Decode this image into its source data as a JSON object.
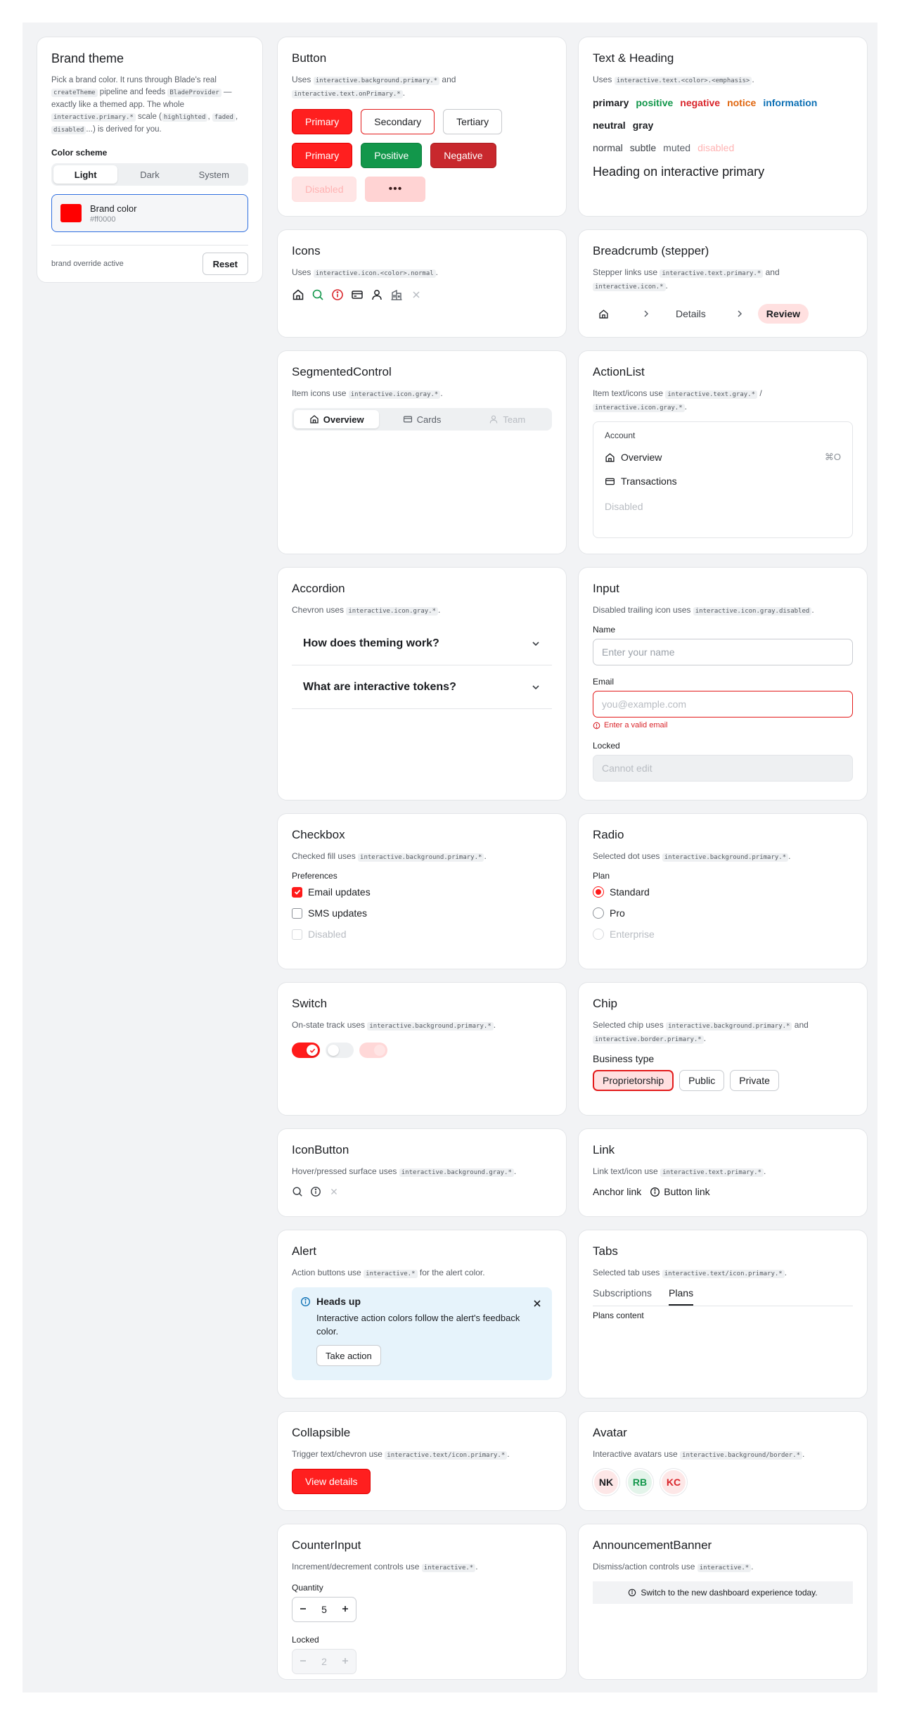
{
  "theme": {
    "title": "Brand theme",
    "desc_parts": [
      "Pick a brand color. It runs through Blade's real ",
      "createTheme",
      " pipeline and feeds ",
      "BladeProvider",
      " — exactly like a themed app. The whole ",
      "interactive.primary.*",
      " scale (",
      "highlighted",
      ", ",
      "faded",
      ", ",
      "disabled",
      "...) is derived for you."
    ],
    "color_scheme_label": "Color scheme",
    "schemes": [
      "Light",
      "Dark",
      "System"
    ],
    "selected_scheme": "Light",
    "brand_label": "Brand color",
    "brand_value": "#ff0000",
    "brand_color": "#ff0000",
    "override_text": "brand override active",
    "reset_label": "Reset"
  },
  "button": {
    "title": "Button",
    "desc_parts": [
      "Uses ",
      "interactive.background.primary.*",
      " and ",
      "interactive.text.onPrimary.*",
      "."
    ],
    "primary": "Primary",
    "secondary": "Secondary",
    "tertiary": "Tertiary",
    "primary2": "Primary",
    "positive": "Positive",
    "negative": "Negative",
    "disabled": "Disabled",
    "loading": "•••"
  },
  "text": {
    "title": "Text & Heading",
    "desc_parts": [
      "Uses ",
      "interactive.text.<color>.<emphasis>",
      "."
    ],
    "row1": [
      {
        "t": "primary",
        "c": "#1b1d21"
      },
      {
        "t": "positive",
        "c": "#12974b"
      },
      {
        "t": "negative",
        "c": "#d9242a"
      },
      {
        "t": "notice",
        "c": "#e0660f"
      },
      {
        "t": "information",
        "c": "#0a6fb4"
      }
    ],
    "row2": [
      {
        "t": "neutral",
        "c": "#1b1d21"
      },
      {
        "t": "gray",
        "c": "#1b1d21"
      }
    ],
    "row3": [
      {
        "t": "normal",
        "c": "#3b3f45"
      },
      {
        "t": "subtle",
        "c": "#3b3f45"
      },
      {
        "t": "muted",
        "c": "#5b6068"
      },
      {
        "t": "disabled",
        "c": "#ffb3b3"
      }
    ],
    "heading": "Heading on interactive primary"
  },
  "icons": {
    "title": "Icons",
    "desc_parts": [
      "Uses ",
      "interactive.icon.<color>.normal",
      "."
    ],
    "list": [
      "home-icon",
      "search-icon",
      "info-icon",
      "card-icon",
      "user-icon",
      "building-icon",
      "close-icon"
    ]
  },
  "breadcrumb": {
    "title": "Breadcrumb (stepper)",
    "desc_parts": [
      "Stepper links use ",
      "interactive.text.primary.*",
      " and ",
      "interactive.icon.*",
      "."
    ],
    "details": "Details",
    "review": "Review"
  },
  "segmented": {
    "title": "SegmentedControl",
    "desc_parts": [
      "Item icons use ",
      "interactive.icon.gray.*",
      "."
    ],
    "options": [
      "Overview",
      "Cards",
      "Team"
    ]
  },
  "actionlist": {
    "title": "ActionList",
    "desc_parts": [
      "Item text/icons use ",
      "interactive.text.gray.*",
      " / ",
      "interactive.icon.gray.*",
      "."
    ],
    "section": "Account",
    "items": [
      "Overview",
      "Transactions",
      "Disabled"
    ],
    "shortcut": "⌘O"
  },
  "accordion": {
    "title": "Accordion",
    "desc_parts": [
      "Chevron uses ",
      "interactive.icon.gray.*",
      "."
    ],
    "items": [
      "How does theming work?",
      "What are interactive tokens?"
    ]
  },
  "input": {
    "title": "Input",
    "desc_parts": [
      "Disabled trailing icon uses ",
      "interactive.icon.gray.disabled",
      "."
    ],
    "name_label": "Name",
    "name_placeholder": "Enter your name",
    "email_label": "Email",
    "email_placeholder": "you@example.com",
    "email_error": "Enter a valid email",
    "locked_label": "Locked",
    "locked_placeholder": "Cannot edit"
  },
  "checkbox": {
    "title": "Checkbox",
    "desc_parts": [
      "Checked fill uses ",
      "interactive.background.primary.*",
      "."
    ],
    "group": "Preferences",
    "items": [
      "Email updates",
      "SMS updates",
      "Disabled"
    ]
  },
  "radio": {
    "title": "Radio",
    "desc_parts": [
      "Selected dot uses ",
      "interactive.background.primary.*",
      "."
    ],
    "group": "Plan",
    "items": [
      "Standard",
      "Pro",
      "Enterprise"
    ]
  },
  "switch": {
    "title": "Switch",
    "desc_parts": [
      "On-state track uses ",
      "interactive.background.primary.*",
      "."
    ]
  },
  "chip": {
    "title": "Chip",
    "desc_parts": [
      "Selected chip uses ",
      "interactive.background.primary.*",
      " and ",
      "interactive.border.primary.*",
      "."
    ],
    "group": "Business type",
    "items": [
      "Proprietorship",
      "Public",
      "Private"
    ]
  },
  "iconbutton": {
    "title": "IconButton",
    "desc_parts": [
      "Hover/pressed surface uses ",
      "interactive.background.gray.*",
      "."
    ]
  },
  "link": {
    "title": "Link",
    "desc_parts": [
      "Link text/icon use ",
      "interactive.text.primary.*",
      "."
    ],
    "anchor": "Anchor link",
    "button": "Button link"
  },
  "alert": {
    "title": "Alert",
    "desc_parts": [
      "Action buttons use ",
      "interactive.*",
      " for the alert color."
    ],
    "heading": "Heads up",
    "body": "Interactive action colors follow the alert's feedback color.",
    "action": "Take action"
  },
  "tabs": {
    "title": "Tabs",
    "desc_parts": [
      "Selected tab uses ",
      "interactive.text/icon.primary.*",
      "."
    ],
    "items": [
      "Subscriptions",
      "Plans"
    ],
    "content": "Plans content"
  },
  "collapsible": {
    "title": "Collapsible",
    "desc_parts": [
      "Trigger text/chevron use ",
      "interactive.text/icon.primary.*",
      "."
    ],
    "trigger": "View details"
  },
  "avatar": {
    "title": "Avatar",
    "desc_parts": [
      "Interactive avatars use ",
      "interactive.background/border.*",
      "."
    ],
    "items": [
      {
        "t": "NK",
        "bg": "#fde7e7",
        "fg": "#1b1d21"
      },
      {
        "t": "RB",
        "bg": "#e3f4ea",
        "fg": "#12974b"
      },
      {
        "t": "KC",
        "bg": "#fde7e7",
        "fg": "#d9242a"
      }
    ]
  },
  "counter": {
    "title": "CounterInput",
    "desc_parts": [
      "Increment/decrement controls use ",
      "interactive.*",
      "."
    ],
    "qty_label": "Quantity",
    "qty": "5",
    "locked_label": "Locked",
    "locked_val": "2"
  },
  "announcement": {
    "title": "AnnouncementBanner",
    "desc_parts": [
      "Dismiss/action controls use ",
      "interactive.*",
      "."
    ],
    "text": "Switch to the new dashboard experience today."
  }
}
